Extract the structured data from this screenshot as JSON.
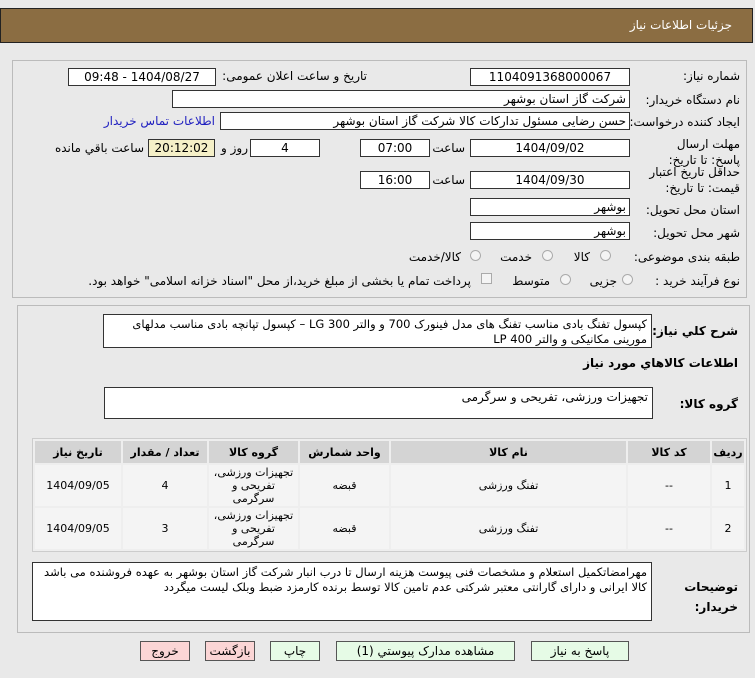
{
  "header": {
    "title": "جزئیات اطلاعات نیاز"
  },
  "form": {
    "need_number_label": "شماره نیاز:",
    "need_number": "1104091368000067",
    "announce_label": "تاریخ و ساعت اعلان عمومی:",
    "announce_value": "1404/08/27 - 09:48",
    "buyer_label": "نام دستگاه خریدار:",
    "buyer": "شرکت گاز استان بوشهر",
    "creator_label": "ایجاد کننده درخواست:",
    "creator": "حسن رضایی مسئول تدارکات کالا شرکت گاز استان بوشهر",
    "contact_link": "اطلاعات تماس خریدار",
    "deadline_label": "مهلت ارسال پاسخ: تا تاریخ:",
    "deadline_date": "1404/09/02",
    "time_label": "ساعت",
    "deadline_time": "07:00",
    "days": "4",
    "days_label": "روز و",
    "remaining": "20:12:02",
    "remaining_label": "ساعت باقي مانده",
    "validity_label": "حداقل تاریخ اعتبار قیمت: تا تاریخ:",
    "validity_date": "1404/09/30",
    "validity_time": "16:00",
    "province_label": "استان محل تحویل:",
    "province": "بوشهر",
    "city_label": "شهر محل تحویل:",
    "city": "بوشهر",
    "category_label": "طبقه بندی موضوعی:",
    "category_options": [
      "کالا",
      "خدمت",
      "کالا/خدمت"
    ],
    "process_label": "نوع فرآیند خرید :",
    "process_options": [
      "جزیی",
      "متوسط"
    ],
    "payment_note": "پرداخت تمام یا بخشی از مبلغ خرید،از محل \"اسناد خزانه اسلامی\" خواهد بود."
  },
  "details": {
    "summary_label": "شرح کلي نياز:",
    "summary": "کپسول تفنگ بادی مناسب تفنگ های مدل فینورک 700 و والتر LG 300 – کپسول تپانچه بادی مناسب مدلهای مورینی مکانیکی و والتر LP 400",
    "goods_info_title": "اطلاعات کالاهاي مورد نياز",
    "group_label": "گروه کالا:",
    "group": "تجهیزات ورزشی، تفریحی و سرگرمی",
    "table": {
      "headers": [
        "ردیف",
        "کد کالا",
        "نام کالا",
        "واحد شمارش",
        "گروه کالا",
        "تعداد / مقدار",
        "تاریخ نیاز"
      ],
      "rows": [
        [
          "1",
          "--",
          "تفنگ ورزشی",
          "قبضه",
          "تجهیزات ورزشی، تفریحی و سرگرمی",
          "4",
          "1404/09/05"
        ],
        [
          "2",
          "--",
          "تفنگ ورزشی",
          "قبضه",
          "تجهیزات ورزشی، تفریحی و سرگرمی",
          "3",
          "1404/09/05"
        ]
      ]
    },
    "notes_label": "توضیحات خریدار:",
    "notes": "مهرامضاتکمیل استعلام و مشخصات فنی پیوست هزینه ارسال تا درب انبار شرکت گاز استان بوشهر به عهده فروشنده می باشد کالا ایرانی و دارای گارانتی معتبر شرکتی  عدم تامین کالا توسط برنده کارمزد ضبط وبلک لیست میگردد"
  },
  "buttons": {
    "reply": "پاسخ به نیاز",
    "attachments": "مشاهده مدارک پیوستي (1)",
    "print": "چاپ",
    "back": "بازگشت",
    "exit": "خروج"
  },
  "colors": {
    "header": "#8b6d42",
    "link": "#2020c0",
    "remaining_bg": "#f5f0c8"
  }
}
